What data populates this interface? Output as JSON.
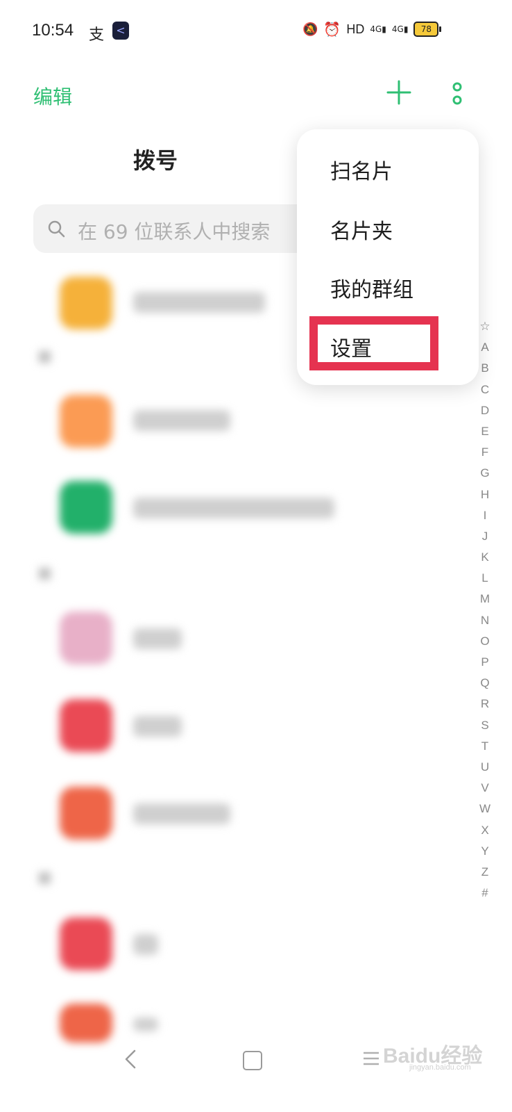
{
  "status_bar": {
    "time": "10:54",
    "network": "HD",
    "signal1": "4G",
    "signal2": "4G",
    "battery": "78"
  },
  "header": {
    "edit_label": "编辑",
    "add_icon": "plus-icon",
    "more_icon": "more-vertical-icon",
    "tab_title": "拨号"
  },
  "search": {
    "placeholder": "在 69 位联系人中搜索"
  },
  "menu": {
    "items": [
      {
        "label": "扫名片"
      },
      {
        "label": "名片夹"
      },
      {
        "label": "我的群组"
      },
      {
        "label": "设置"
      }
    ],
    "highlighted_item": "设置",
    "highlight_color": "#e53350"
  },
  "alphabet_index": [
    "☆",
    "A",
    "B",
    "C",
    "D",
    "E",
    "F",
    "G",
    "H",
    "I",
    "J",
    "K",
    "L",
    "M",
    "N",
    "O",
    "P",
    "Q",
    "R",
    "S",
    "T",
    "U",
    "V",
    "W",
    "X",
    "Y",
    "Z",
    "#"
  ],
  "colors": {
    "accent": "#2fbf73",
    "avatar_colors": [
      "#f5b13a",
      "#fb9b54",
      "#22b06a",
      "#e8b0c8",
      "#ea4a55",
      "#ee6548",
      "#ea4a55",
      "#ee6548"
    ]
  },
  "watermark": {
    "text": "Baidu经验",
    "sub": "jingyan.baidu.com"
  }
}
